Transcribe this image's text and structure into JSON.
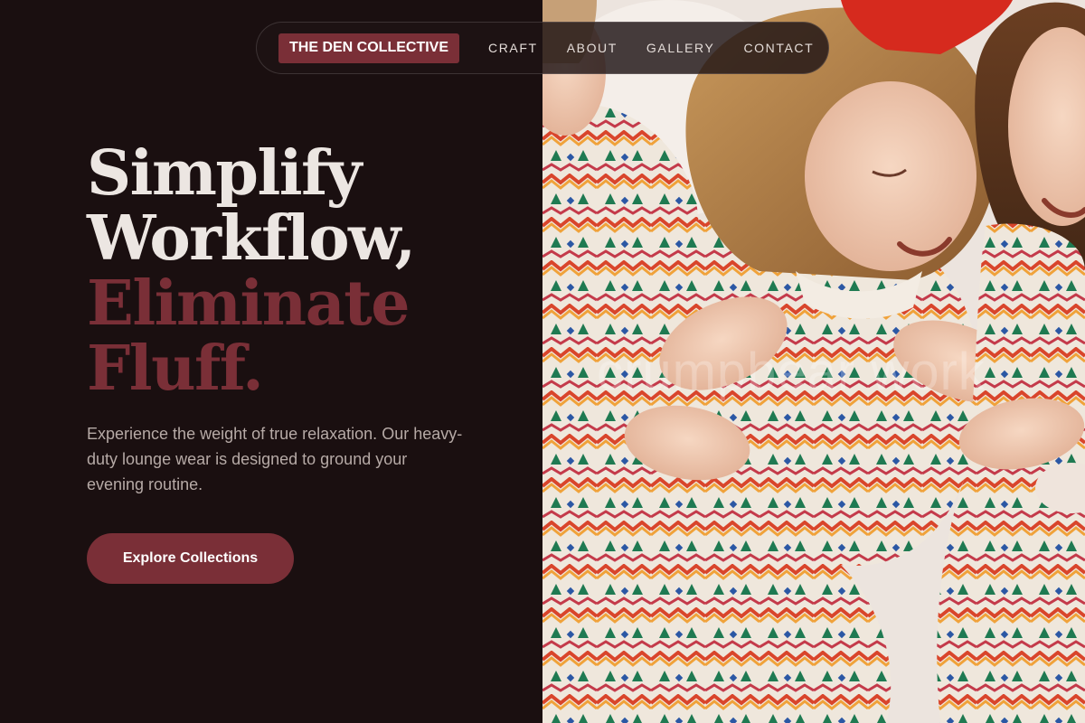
{
  "nav": {
    "brand": "THE DEN COLLECTIVE",
    "links": [
      "CRAFT",
      "ABOUT",
      "GALLERY",
      "CONTACT"
    ]
  },
  "hero": {
    "headline_line1": "Simplify",
    "headline_line2": "Workflow,",
    "headline_line3": "Eliminate",
    "headline_line4": "Fluff.",
    "description": "Experience the weight of true relaxation. Our heavy-duty lounge wear is designed to ground your evening routine.",
    "cta_label": "Explore Collections"
  },
  "photo": {
    "watermark": "crumpbear work"
  },
  "colors": {
    "background": "#1a0f10",
    "accent": "#7a2f37",
    "headline_light": "#ece6e2",
    "body_text": "#b6aaa6"
  }
}
